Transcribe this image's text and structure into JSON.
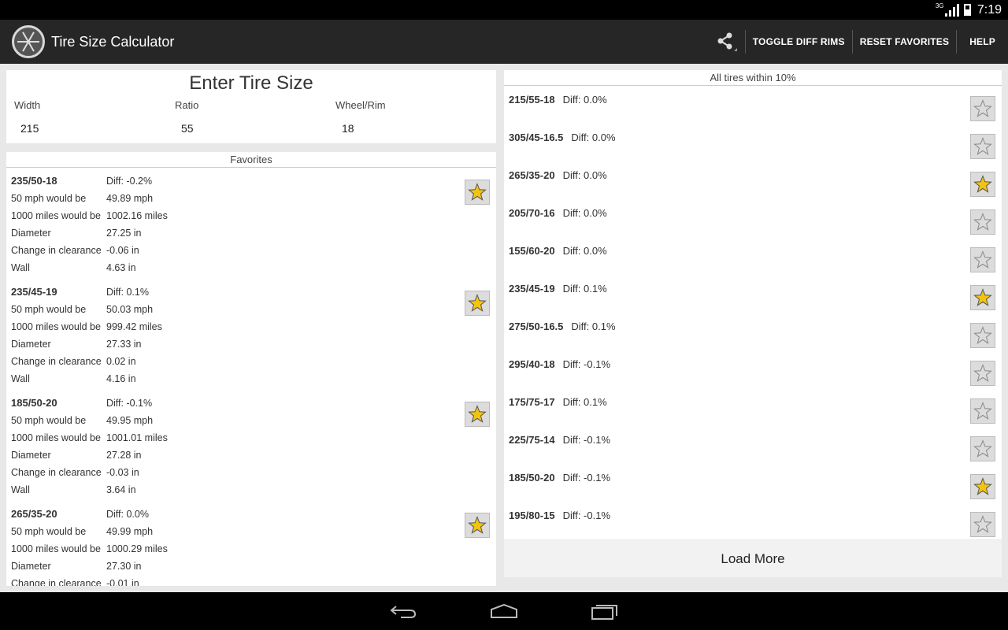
{
  "status": {
    "network": "3G",
    "time": "7:19"
  },
  "app": {
    "title": "Tire Size Calculator",
    "actions": [
      "TOGGLE DIFF RIMS",
      "RESET FAVORITES",
      "HELP"
    ]
  },
  "enter": {
    "title": "Enter Tire Size",
    "width_label": "Width",
    "width_value": "215",
    "ratio_label": "Ratio",
    "ratio_value": "55",
    "rim_label": "Wheel/Rim",
    "rim_value": "18"
  },
  "favorites": {
    "header": "Favorites",
    "labels": {
      "speed": "50 mph would be",
      "distance": "1000 miles would be",
      "diameter": "Diameter",
      "clearance": "Change in clearance",
      "wall": "Wall"
    },
    "items": [
      {
        "size": "235/50-18",
        "diff": "Diff: -0.2%",
        "speed": "49.89 mph",
        "distance": "1002.16 miles",
        "diameter": "27.25 in",
        "clearance": "-0.06 in",
        "wall": "4.63 in",
        "favorite": true
      },
      {
        "size": "235/45-19",
        "diff": "Diff: 0.1%",
        "speed": "50.03 mph",
        "distance": "999.42 miles",
        "diameter": "27.33 in",
        "clearance": "0.02 in",
        "wall": "4.16 in",
        "favorite": true
      },
      {
        "size": "185/50-20",
        "diff": "Diff: -0.1%",
        "speed": "49.95 mph",
        "distance": "1001.01 miles",
        "diameter": "27.28 in",
        "clearance": "-0.03 in",
        "wall": "3.64 in",
        "favorite": true
      },
      {
        "size": "265/35-20",
        "diff": "Diff: 0.0%",
        "speed": "49.99 mph",
        "distance": "1000.29 miles",
        "diameter": "27.30 in",
        "clearance": "-0.01 in",
        "wall": "",
        "favorite": true
      }
    ]
  },
  "all_tires": {
    "header": "All tires within 10%",
    "items": [
      {
        "size": "215/55-18",
        "diff": "Diff: 0.0%",
        "favorite": false
      },
      {
        "size": "305/45-16.5",
        "diff": "Diff: 0.0%",
        "favorite": false
      },
      {
        "size": "265/35-20",
        "diff": "Diff: 0.0%",
        "favorite": true
      },
      {
        "size": "205/70-16",
        "diff": "Diff: 0.0%",
        "favorite": false
      },
      {
        "size": "155/60-20",
        "diff": "Diff: 0.0%",
        "favorite": false
      },
      {
        "size": "235/45-19",
        "diff": "Diff: 0.1%",
        "favorite": true
      },
      {
        "size": "275/50-16.5",
        "diff": "Diff: 0.1%",
        "favorite": false
      },
      {
        "size": "295/40-18",
        "diff": "Diff: -0.1%",
        "favorite": false
      },
      {
        "size": "175/75-17",
        "diff": "Diff: 0.1%",
        "favorite": false
      },
      {
        "size": "225/75-14",
        "diff": "Diff: -0.1%",
        "favorite": false
      },
      {
        "size": "185/50-20",
        "diff": "Diff: -0.1%",
        "favorite": true
      },
      {
        "size": "195/80-15",
        "diff": "Diff: -0.1%",
        "favorite": false
      }
    ],
    "load_more": "Load More"
  },
  "colors": {
    "star_filled": "#f2c40f",
    "star_outline": "#888888",
    "action_bar": "#262626"
  },
  "icons": [
    "share-icon",
    "back-icon",
    "home-icon",
    "recents-icon",
    "star-icon"
  ]
}
